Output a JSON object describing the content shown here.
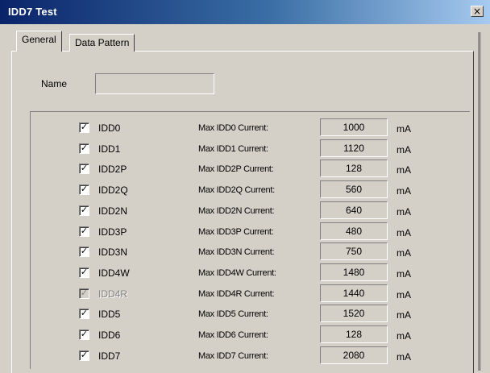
{
  "window": {
    "title": "IDD7 Test",
    "close_glyph": "×"
  },
  "tabs": [
    {
      "label": "General",
      "active": true
    },
    {
      "label": "Data Pattern",
      "active": false
    }
  ],
  "name_field": {
    "label": "Name",
    "value": ""
  },
  "rows": [
    {
      "label": "IDD0",
      "checked": true,
      "enabled": true,
      "current_label": "Max IDD0 Current:",
      "value": "1000",
      "unit": "mA"
    },
    {
      "label": "IDD1",
      "checked": true,
      "enabled": true,
      "current_label": "Max IDD1 Current:",
      "value": "1120",
      "unit": "mA"
    },
    {
      "label": "IDD2P",
      "checked": true,
      "enabled": true,
      "current_label": "Max IDD2P Current:",
      "value": "128",
      "unit": "mA"
    },
    {
      "label": "IDD2Q",
      "checked": true,
      "enabled": true,
      "current_label": "Max IDD2Q Current:",
      "value": "560",
      "unit": "mA"
    },
    {
      "label": "IDD2N",
      "checked": true,
      "enabled": true,
      "current_label": "Max IDD2N Current:",
      "value": "640",
      "unit": "mA"
    },
    {
      "label": "IDD3P",
      "checked": true,
      "enabled": true,
      "current_label": "Max IDD3P Current:",
      "value": "480",
      "unit": "mA"
    },
    {
      "label": "IDD3N",
      "checked": true,
      "enabled": true,
      "current_label": "Max IDD3N Current:",
      "value": "750",
      "unit": "mA"
    },
    {
      "label": "IDD4W",
      "checked": true,
      "enabled": true,
      "current_label": "Max IDD4W Current:",
      "value": "1480",
      "unit": "mA"
    },
    {
      "label": "IDD4R",
      "checked": true,
      "enabled": false,
      "current_label": "Max IDD4R Current:",
      "value": "1440",
      "unit": "mA"
    },
    {
      "label": "IDD5",
      "checked": true,
      "enabled": true,
      "current_label": "Max IDD5 Current:",
      "value": "1520",
      "unit": "mA"
    },
    {
      "label": "IDD6",
      "checked": true,
      "enabled": true,
      "current_label": "Max IDD6 Current:",
      "value": "128",
      "unit": "mA"
    },
    {
      "label": "IDD7",
      "checked": true,
      "enabled": true,
      "current_label": "Max IDD7 Current:",
      "value": "2080",
      "unit": "mA"
    }
  ],
  "check_glyph": "✓"
}
